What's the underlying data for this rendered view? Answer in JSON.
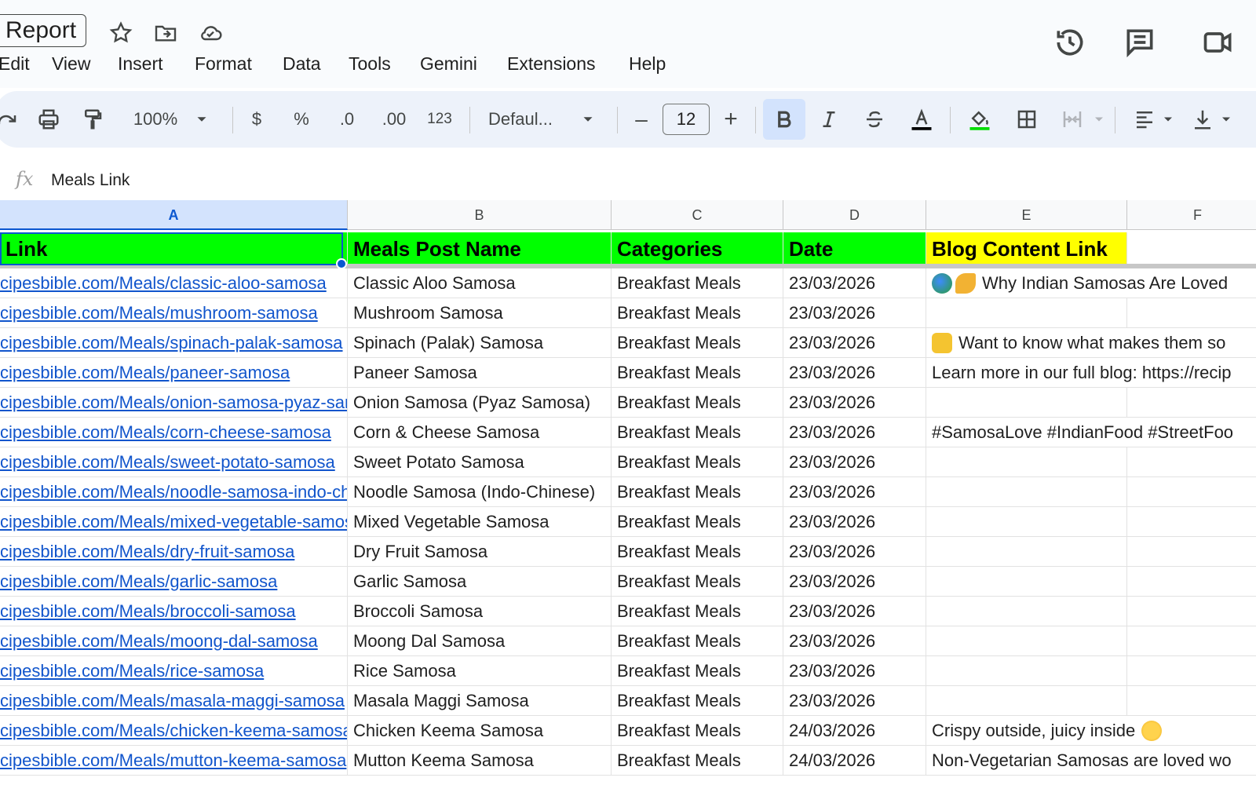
{
  "doc": {
    "title": "Report"
  },
  "menu": [
    "Edit",
    "View",
    "Insert",
    "Format",
    "Data",
    "Tools",
    "Gemini",
    "Extensions",
    "Help"
  ],
  "toolbar": {
    "zoom": "100%",
    "currency": "$",
    "percent": "%",
    "decrease_decimal": ".0",
    "increase_decimal": ".00",
    "more_formats": "123",
    "font": "Defaul...",
    "font_size": "12",
    "minus": "–",
    "plus": "+"
  },
  "formula_bar": {
    "fx": "fx",
    "value": "Meals Link"
  },
  "columns": [
    "A",
    "B",
    "C",
    "D",
    "E",
    "F"
  ],
  "header_row": {
    "a": "Link",
    "b": "Meals Post Name",
    "c": "Categories",
    "d": "Date",
    "e": "Blog Content Link"
  },
  "rows": [
    {
      "link": "cipesbible.com/Meals/classic-aloo-samosa",
      "name": "Classic Aloo Samosa",
      "category": "Breakfast Meals",
      "date": "23/03/2026",
      "e": "Why Indian Samosas Are Loved"
    },
    {
      "link": "cipesbible.com/Meals/mushroom-samosa",
      "name": "Mushroom Samosa",
      "category": "Breakfast Meals",
      "date": "23/03/2026",
      "e": ""
    },
    {
      "link": "cipesbible.com/Meals/spinach-palak-samosa",
      "name": "Spinach (Palak) Samosa",
      "category": "Breakfast Meals",
      "date": "23/03/2026",
      "e": "Want to know what makes them so"
    },
    {
      "link": "cipesbible.com/Meals/paneer-samosa",
      "name": "Paneer Samosa",
      "category": "Breakfast Meals",
      "date": "23/03/2026",
      "e": "Learn more in our full blog: https://recip"
    },
    {
      "link": "cipesbible.com/Meals/onion-samosa-pyaz-samosa",
      "name": "Onion Samosa (Pyaz Samosa)",
      "category": "Breakfast Meals",
      "date": "23/03/2026",
      "e": ""
    },
    {
      "link": "cipesbible.com/Meals/corn-cheese-samosa",
      "name": "Corn & Cheese Samosa",
      "category": "Breakfast Meals",
      "date": "23/03/2026",
      "e": "#SamosaLove #IndianFood #StreetFoo"
    },
    {
      "link": "cipesbible.com/Meals/sweet-potato-samosa",
      "name": "Sweet Potato Samosa",
      "category": "Breakfast Meals",
      "date": "23/03/2026",
      "e": ""
    },
    {
      "link": "cipesbible.com/Meals/noodle-samosa-indo-chinese",
      "name": "Noodle Samosa (Indo-Chinese)",
      "category": "Breakfast Meals",
      "date": "23/03/2026",
      "e": ""
    },
    {
      "link": "cipesbible.com/Meals/mixed-vegetable-samosa",
      "name": "Mixed Vegetable Samosa",
      "category": "Breakfast Meals",
      "date": "23/03/2026",
      "e": ""
    },
    {
      "link": "cipesbible.com/Meals/dry-fruit-samosa",
      "name": "Dry Fruit Samosa",
      "category": "Breakfast Meals",
      "date": "23/03/2026",
      "e": ""
    },
    {
      "link": "cipesbible.com/Meals/garlic-samosa",
      "name": "Garlic Samosa",
      "category": "Breakfast Meals",
      "date": "23/03/2026",
      "e": ""
    },
    {
      "link": "cipesbible.com/Meals/broccoli-samosa",
      "name": "Broccoli Samosa",
      "category": "Breakfast Meals",
      "date": "23/03/2026",
      "e": ""
    },
    {
      "link": "cipesbible.com/Meals/moong-dal-samosa",
      "name": "Moong Dal Samosa",
      "category": "Breakfast Meals",
      "date": "23/03/2026",
      "e": ""
    },
    {
      "link": "cipesbible.com/Meals/rice-samosa",
      "name": "Rice Samosa",
      "category": "Breakfast Meals",
      "date": "23/03/2026",
      "e": ""
    },
    {
      "link": "cipesbible.com/Meals/masala-maggi-samosa",
      "name": "Masala Maggi Samosa",
      "category": "Breakfast Meals",
      "date": "23/03/2026",
      "e": ""
    },
    {
      "link": "cipesbible.com/Meals/chicken-keema-samosa",
      "name": "Chicken Keema Samosa",
      "category": "Breakfast Meals",
      "date": "24/03/2026",
      "e": "Crispy outside, juicy inside"
    },
    {
      "link": "cipesbible.com/Meals/mutton-keema-samosa",
      "name": "Mutton Keema Samosa",
      "category": "Breakfast Meals",
      "date": "24/03/2026",
      "e": "Non-Vegetarian Samosas are loved wo"
    }
  ]
}
